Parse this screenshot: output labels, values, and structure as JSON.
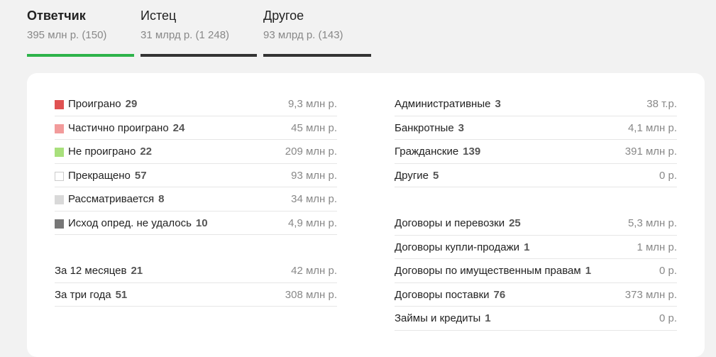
{
  "tabs": [
    {
      "title": "Ответчик",
      "subtitle": "395 млн р. (150)",
      "active": true
    },
    {
      "title": "Истец",
      "subtitle": "31 млрд р. (1 248)",
      "active": false
    },
    {
      "title": "Другое",
      "subtitle": "93 млрд р. (143)",
      "active": false
    }
  ],
  "outcomes": [
    {
      "label": "Проиграно",
      "count": "29",
      "amount": "9,3 млн р.",
      "color": "#e05252"
    },
    {
      "label": "Частично проиграно",
      "count": "24",
      "amount": "45 млн р.",
      "color": "#f29b9b"
    },
    {
      "label": "Не проиграно",
      "count": "22",
      "amount": "209 млн р.",
      "color": "#a8e07c"
    },
    {
      "label": "Прекращено",
      "count": "57",
      "amount": "93 млн р.",
      "color": "#ffffff"
    },
    {
      "label": "Рассматривается",
      "count": "8",
      "amount": "34 млн р.",
      "color": "#d9d9d9"
    },
    {
      "label": "Исход опред. не удалось",
      "count": "10",
      "amount": "4,9 млн р.",
      "color": "#777777"
    }
  ],
  "periods": [
    {
      "label": "За 12 месяцев",
      "count": "21",
      "amount": "42 млн р."
    },
    {
      "label": "За три года",
      "count": "51",
      "amount": "308 млн р."
    }
  ],
  "case_types": [
    {
      "label": "Административные",
      "count": "3",
      "amount": "38 т.р."
    },
    {
      "label": "Банкротные",
      "count": "3",
      "amount": "4,1 млн р."
    },
    {
      "label": "Гражданские",
      "count": "139",
      "amount": "391 млн р."
    },
    {
      "label": "Другие",
      "count": "5",
      "amount": "0 р."
    }
  ],
  "categories": [
    {
      "label": "Договоры и перевозки",
      "count": "25",
      "amount": "5,3 млн р."
    },
    {
      "label": "Договоры купли-продажи",
      "count": "1",
      "amount": "1 млн р."
    },
    {
      "label": "Договоры по имущественным правам",
      "count": "1",
      "amount": "0 р."
    },
    {
      "label": "Договоры поставки",
      "count": "76",
      "amount": "373 млн р."
    },
    {
      "label": "Займы и кредиты",
      "count": "1",
      "amount": "0 р."
    }
  ]
}
